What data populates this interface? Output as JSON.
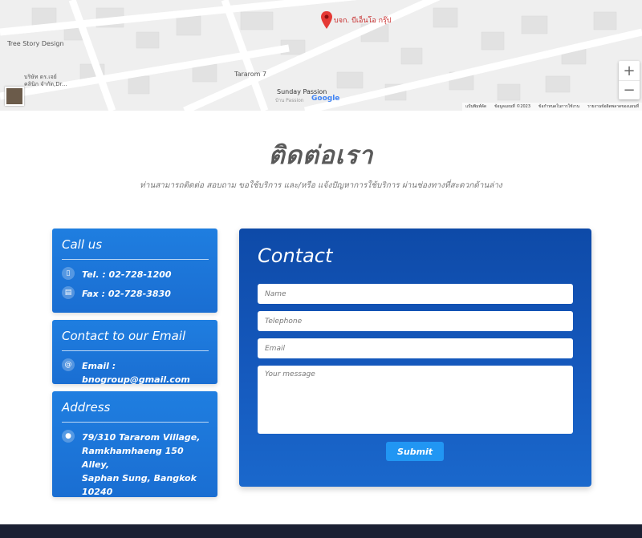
{
  "map": {
    "place_name": "บจก. บีเอ็นโอ กรุ๊ป",
    "labels": [
      "Tree Story Design",
      "Tararom 7",
      "Sunday Passion",
      "บริษัท ดร.เจย์ คลินิก จำกัด,Dr...",
      "บ้าน Passion"
    ],
    "google": "Google",
    "footer": [
      "แป้นพิมพ์ลัด",
      "ข้อมูลแผนที่ ©2023",
      "ข้อกำหนดในการใช้งาน",
      "รายงานข้อผิดพลาดของแผนที่"
    ],
    "zoom_in": "+",
    "zoom_out": "−"
  },
  "page": {
    "title": "ติดต่อเรา",
    "subtitle": "ท่านสามารถติดต่อ สอบถาม ขอใช้บริการ และ/หรือ แจ้งปัญหาการใช้บริการ ผ่านช่องทางที่สะดวกด้านล่าง"
  },
  "call": {
    "title": "Call us",
    "tel": "Tel. : 02-728-1200",
    "fax": "Fax : 02-728-3830"
  },
  "email": {
    "title": "Contact to our Email",
    "value": "Email : bnogroup@gmail.com"
  },
  "address": {
    "title": "Address",
    "lines": [
      "79/310 Tararom Village,",
      "Ramkhamhaeng 150 Alley,",
      "Saphan Sung, Bangkok",
      "10240"
    ]
  },
  "form": {
    "title": "Contact",
    "name_placeholder": "Name",
    "telephone_placeholder": "Telephone",
    "email_placeholder": "Email",
    "message_placeholder": "Your message",
    "submit_label": "Submit"
  },
  "colors": {
    "card": "#1f7ee0",
    "panel": "#0e4aa8",
    "submit": "#2196f3",
    "footer": "#1b2033"
  }
}
